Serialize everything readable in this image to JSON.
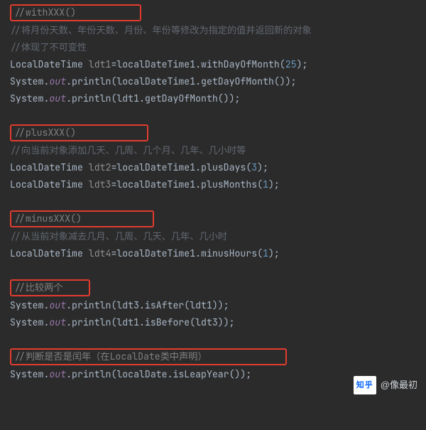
{
  "sections": [
    {
      "header": "//withXXX()",
      "boxClass": "wide",
      "lines": [
        {
          "type": "dimComment",
          "text": "//将月份天数、年份天数、月份、年份等修改为指定的值并返回新的对象"
        },
        {
          "type": "dimComment",
          "text": "//体现了不可变性"
        },
        {
          "type": "code",
          "tokens": [
            {
              "c": "t",
              "s": "LocalDateTime "
            },
            {
              "c": "v",
              "s": "ldt1"
            },
            {
              "c": "t",
              "s": "=localDateTime1.withDayOfMonth("
            },
            {
              "c": "num",
              "s": "25"
            },
            {
              "c": "t",
              "s": ");"
            }
          ]
        },
        {
          "type": "code",
          "tokens": [
            {
              "c": "t",
              "s": "System."
            },
            {
              "c": "f",
              "s": "out"
            },
            {
              "c": "t",
              "s": ".println(localDateTime1.getDayOfMonth());"
            }
          ]
        },
        {
          "type": "code",
          "tokens": [
            {
              "c": "t",
              "s": "System."
            },
            {
              "c": "f",
              "s": "out"
            },
            {
              "c": "t",
              "s": ".println(ldt1.getDayOfMonth());"
            }
          ]
        }
      ]
    },
    {
      "header": "//plusXXX()",
      "boxClass": "w2",
      "lines": [
        {
          "type": "dimComment",
          "text": "//向当前对象添加几天、几周、几个月、几年、几小时等"
        },
        {
          "type": "code",
          "tokens": [
            {
              "c": "t",
              "s": "LocalDateTime "
            },
            {
              "c": "v",
              "s": "ldt2"
            },
            {
              "c": "t",
              "s": "=localDateTime1.plusDays("
            },
            {
              "c": "num",
              "s": "3"
            },
            {
              "c": "t",
              "s": ");"
            }
          ]
        },
        {
          "type": "code",
          "tokens": [
            {
              "c": "t",
              "s": "LocalDateTime "
            },
            {
              "c": "v",
              "s": "ldt3"
            },
            {
              "c": "t",
              "s": "=localDateTime1.plusMonths("
            },
            {
              "c": "num",
              "s": "1"
            },
            {
              "c": "t",
              "s": ");"
            }
          ]
        }
      ]
    },
    {
      "header": "//minusXXX()",
      "boxClass": "w3",
      "lines": [
        {
          "type": "dimComment",
          "text": "//从当前对象减去几月、几周、几天、几年、几小时"
        },
        {
          "type": "code",
          "tokens": [
            {
              "c": "t",
              "s": "LocalDateTime "
            },
            {
              "c": "v",
              "s": "ldt4"
            },
            {
              "c": "t",
              "s": "=localDateTime1.minusHours("
            },
            {
              "c": "num",
              "s": "1"
            },
            {
              "c": "t",
              "s": ");"
            }
          ]
        }
      ]
    },
    {
      "header": "//比较两个",
      "boxClass": "w4",
      "lines": [
        {
          "type": "code",
          "tokens": [
            {
              "c": "t",
              "s": "System."
            },
            {
              "c": "f",
              "s": "out"
            },
            {
              "c": "t",
              "s": ".println(ldt3.isAfter(ldt1));"
            }
          ]
        },
        {
          "type": "code",
          "tokens": [
            {
              "c": "t",
              "s": "System."
            },
            {
              "c": "f",
              "s": "out"
            },
            {
              "c": "t",
              "s": ".println(ldt1.isBefore(ldt3));"
            }
          ]
        }
      ]
    },
    {
      "header": "//判断是否是闰年（在LocalDate类中声明）",
      "boxClass": "w5",
      "lines": [
        {
          "type": "code",
          "tokens": [
            {
              "c": "t",
              "s": "System."
            },
            {
              "c": "f",
              "s": "out"
            },
            {
              "c": "t",
              "s": ".println(localDate.isLeapYear());"
            }
          ]
        }
      ]
    }
  ],
  "watermark": {
    "logo": "知乎",
    "user": "@像最初"
  }
}
